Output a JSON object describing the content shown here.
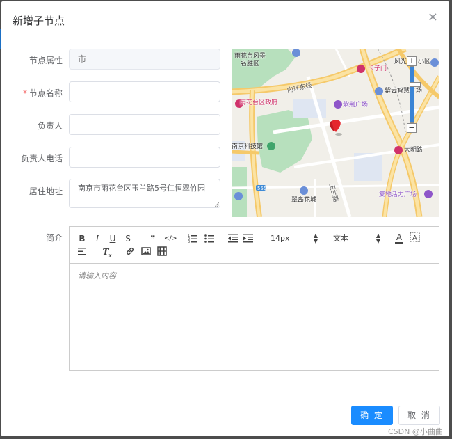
{
  "dialog": {
    "title": "新增子节点",
    "close_glyph": "×"
  },
  "form": {
    "attr_label": "节点属性",
    "attr_placeholder": "市",
    "name_required_mark": "*",
    "name_label": "节点名称",
    "name_value": "",
    "owner_label": "负责人",
    "owner_value": "",
    "phone_label": "负责人电话",
    "phone_value": "",
    "address_label": "居住地址",
    "address_value": "南京市雨花台区玉兰路5号仁恒翠竹园",
    "intro_label": "简介"
  },
  "map": {
    "labels": {
      "scenic": "雨花台风景\n名胜区",
      "kaizimen": "卡子门",
      "fengguang": "风光",
      "xiaoqu": "小区",
      "ring_road": "内环东线",
      "ziyun": "紫云智慧广场",
      "gov": "雨花台区政府",
      "zijing": "紫荆广场",
      "museum": "南京科技馆",
      "daming": "大明路",
      "road_555": "555",
      "yulan_road": "玉兰路",
      "cuidao": "翠岛花城",
      "fudi": "复地活力广场"
    },
    "zoom_in": "+",
    "zoom_out": "−"
  },
  "editor": {
    "font_size": "14px",
    "header": "文本",
    "placeholder": "请输入内容",
    "toolbar": {
      "bold": "B",
      "italic": "I",
      "underline": "U",
      "strike": "S",
      "quote": "❞",
      "code": "</>",
      "color": "A",
      "clean": "T"
    }
  },
  "footer": {
    "confirm": "确 定",
    "cancel": "取 消"
  },
  "watermark": "CSDN @小曲曲",
  "colors": {
    "primary": "#1a8cff",
    "required": "#f56c6c",
    "marker": "#e5272d"
  }
}
